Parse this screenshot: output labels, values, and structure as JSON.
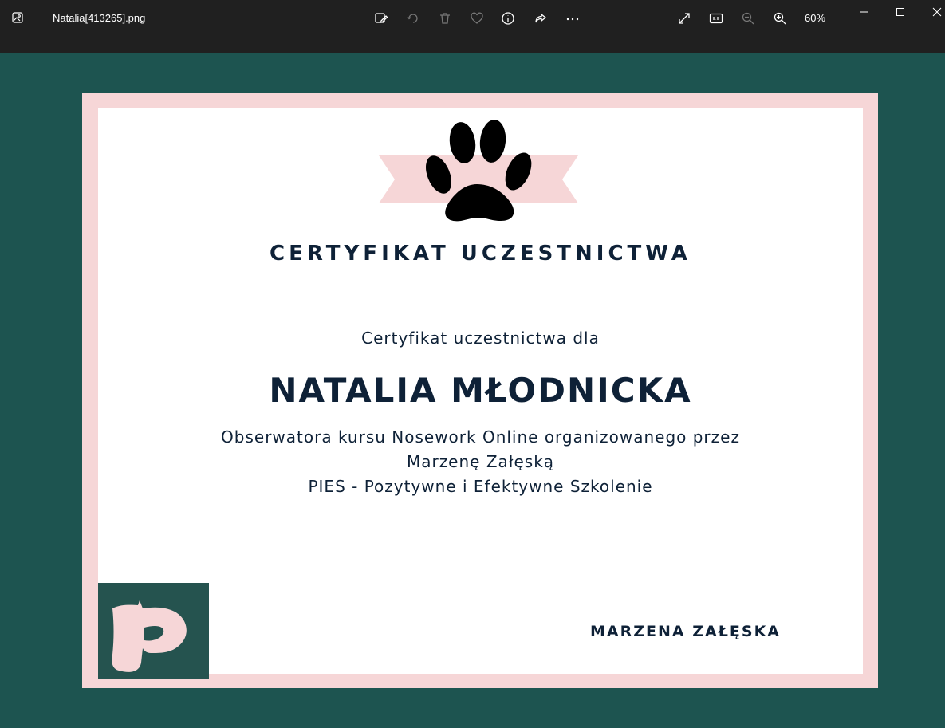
{
  "titlebar": {
    "file_name": "Natalia[413265].png",
    "zoom_level": "60%",
    "icons": [
      "image-app-icon",
      "edit-image-icon",
      "rotate-icon",
      "delete-icon",
      "favorite-icon",
      "info-icon",
      "share-icon",
      "more-icon",
      "fullscreen-icon",
      "actual-size-icon",
      "zoom-out-icon",
      "zoom-in-icon"
    ],
    "window_controls": [
      "minimize-icon",
      "maximize-icon",
      "close-icon"
    ]
  },
  "certificate": {
    "title": "CERTYFIKAT UCZESTNICTWA",
    "for_label": "Certyfikat uczestnictwa dla",
    "recipient": "NATALIA MŁODNICKA",
    "description": [
      "Obserwatora kursu Nosework Online organizowanego przez",
      "Marzenę Załęską",
      "PIES - Pozytywne i Efektywne Szkolenie"
    ],
    "signature": "MARZENA ZAŁĘSKA",
    "colors": {
      "frame": "#f6d6d7",
      "background": "#1d5450",
      "text": "#0e2137",
      "logo_bg": "#25534f"
    }
  }
}
